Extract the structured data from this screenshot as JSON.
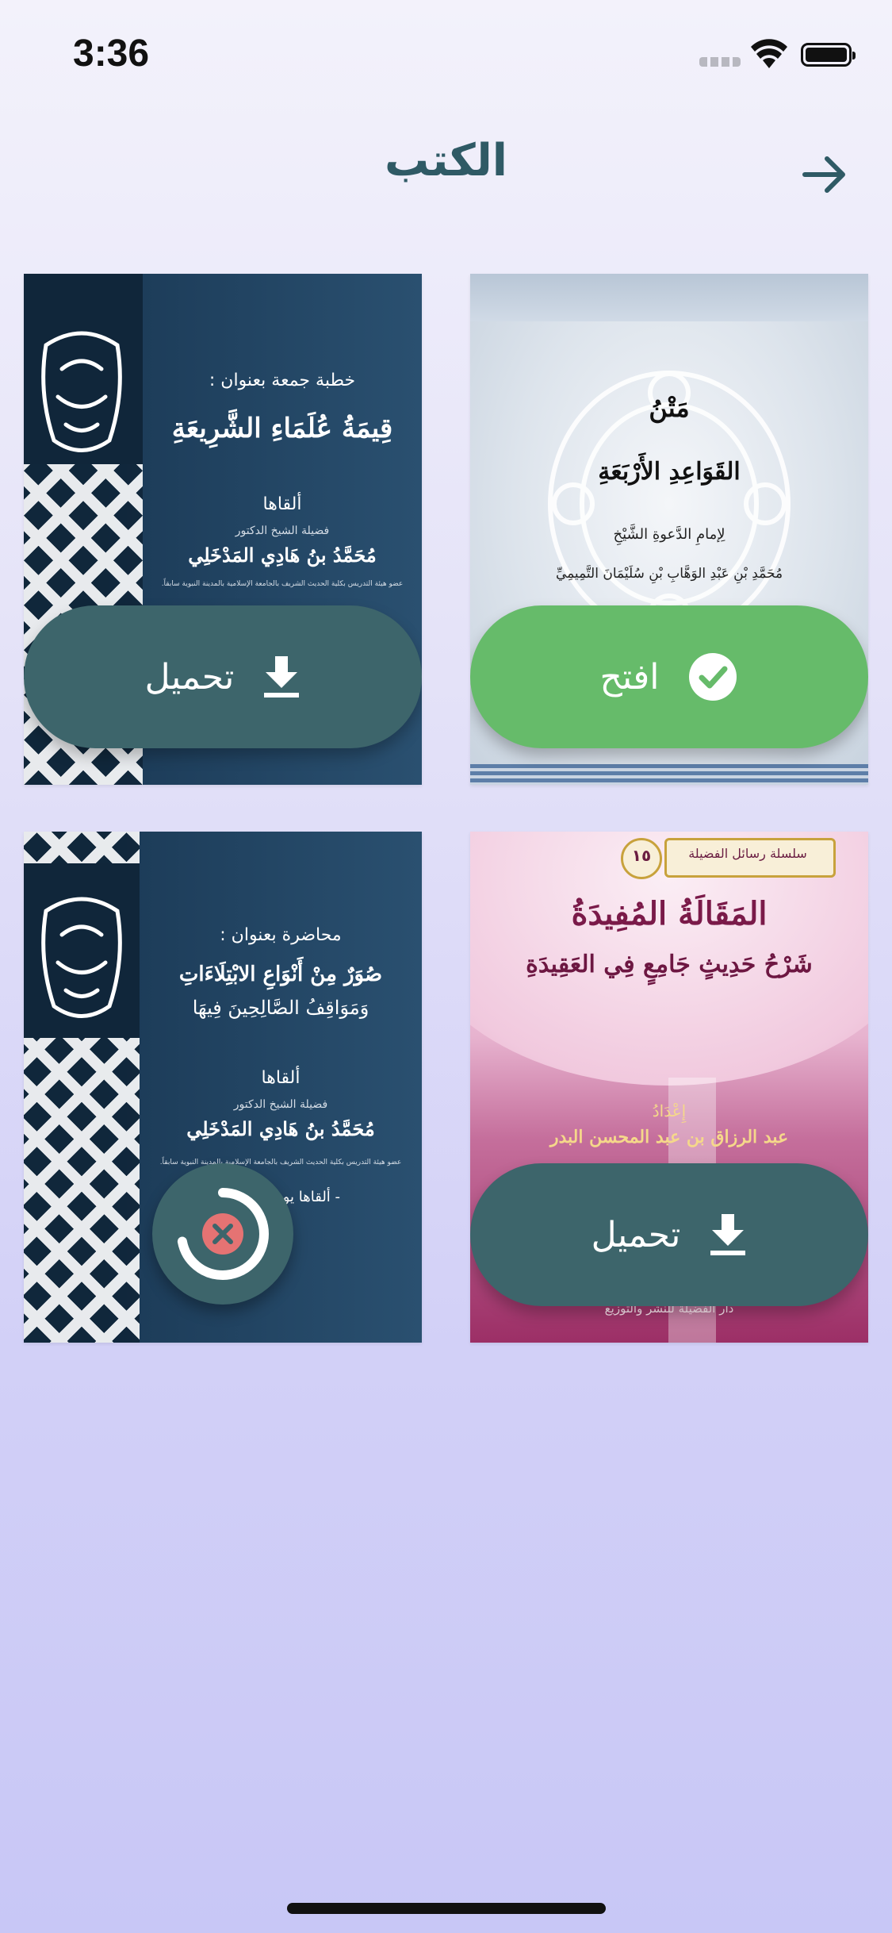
{
  "status_bar": {
    "time": "3:36"
  },
  "header": {
    "title": "الكتب",
    "back_icon": "arrow-right-icon"
  },
  "books": [
    {
      "cover_lines": [
        "مَتْنُ",
        "القَوَاعِدِ الأَرْبَعَةِ",
        "لِإمامِ الدَّعوةِ الشَّيْخِ",
        "مُحَمَّدِ بْنِ عَبْدِ الوَهَّابِ بْنِ سُلَيْمَانَ التَّمِيمِيِّ"
      ],
      "action": {
        "label": "افتح",
        "icon": "check-circle-icon",
        "state": "downloaded"
      }
    },
    {
      "cover_lines": [
        "خطبة جمعة بعنوان :",
        "قِيمَةُ عُلَمَاءِ الشَّرِيعَةِ",
        "ألقاها",
        "فضيلة الشيخ الدكتور",
        "مُحَمَّدُ بنُ هَادِي المَدْخَلِي",
        "عضو هيئة التدريس بكلية الحديث الشريف بالجامعة الإسلامية بالمدينة النبوية سابقاً."
      ],
      "action": {
        "label": "تحميل",
        "icon": "download-icon",
        "state": "not_downloaded"
      }
    },
    {
      "cover_lines": [
        "سلسلة رسائل الفضيلة",
        "١٥",
        "المَقَالَةُ المُفِيدَةُ",
        "شَرْحُ حَدِيثٍ جَامِعٍ فِي العَقِيدَةِ",
        "إِعْدَادُ",
        "عبد الرزاق بن عبد المحسن البدر",
        "دار الفضيلة للنشر والتوزيع"
      ],
      "action": {
        "label": "تحميل",
        "icon": "download-icon",
        "state": "not_downloaded"
      }
    },
    {
      "cover_lines": [
        "محاضرة بعنوان :",
        "صُوَرٌ مِنْ أَنْوَاعِ الابْتِلَاءَاتِ",
        "وَمَوَاقِفُ الصَّالِحِينَ فِيهَا",
        "ألقاها",
        "فضيلة الشيخ الدكتور",
        "مُحَمَّدُ بنُ هَادِي المَدْخَلِي",
        "عضو هيئة التدريس بكلية الحديث الشريف بالجامعة الإسلامية بالمدينة النبوية سابقاً.",
        "- ألقاها يوم الخميس"
      ],
      "action": {
        "icon": "cancel-download-icon",
        "state": "downloading",
        "progress": 0.72
      }
    }
  ],
  "colors": {
    "download_button": "#3d656b",
    "open_button": "#66bb6a",
    "cancel_icon": "#e57373",
    "title": "#2f5a65"
  }
}
